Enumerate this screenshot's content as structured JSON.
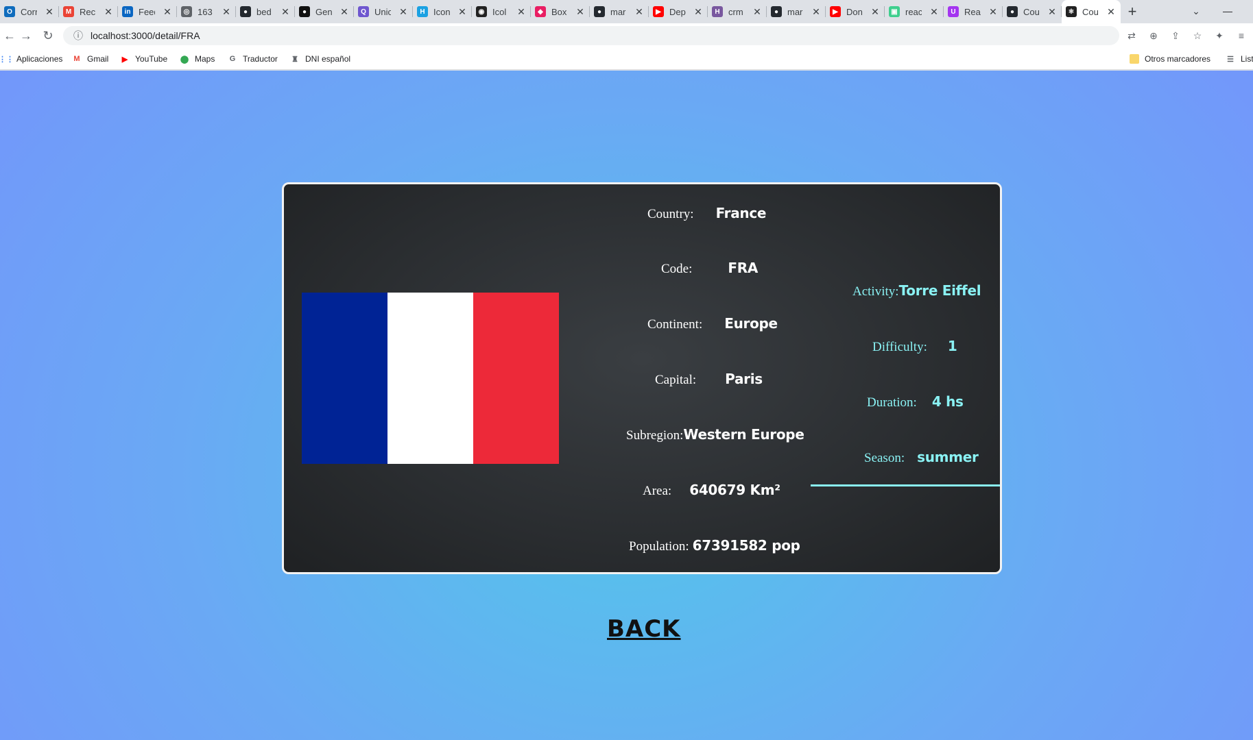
{
  "browser": {
    "tabs": [
      {
        "title": "Corr",
        "icon": "outlook-icon",
        "color": "#0f6cbd",
        "glyph": "O"
      },
      {
        "title": "Reci",
        "icon": "gmail-icon",
        "color": "#ea4335",
        "glyph": "M"
      },
      {
        "title": "Feed",
        "icon": "linkedin-icon",
        "color": "#0a66c2",
        "glyph": "in"
      },
      {
        "title": "163",
        "icon": "globe-icon",
        "color": "#5f6368",
        "glyph": "◎"
      },
      {
        "title": "bed",
        "icon": "github-icon",
        "color": "#24292f",
        "glyph": "●"
      },
      {
        "title": "Gen",
        "icon": "dot-icon",
        "color": "#111111",
        "glyph": "●"
      },
      {
        "title": "Unic",
        "icon": "search-icon",
        "color": "#6e56cf",
        "glyph": "Q"
      },
      {
        "title": "Icon",
        "icon": "iconify-icon",
        "color": "#1ba1e2",
        "glyph": "H"
      },
      {
        "title": "Icol",
        "icon": "icon-app-icon",
        "color": "#222222",
        "glyph": "◉"
      },
      {
        "title": "Box",
        "icon": "box-icon",
        "color": "#e91e63",
        "glyph": "◆"
      },
      {
        "title": "mar",
        "icon": "github-icon",
        "color": "#24292f",
        "glyph": "●"
      },
      {
        "title": "Dep",
        "icon": "youtube-icon",
        "color": "#ff0000",
        "glyph": "▶"
      },
      {
        "title": "crm",
        "icon": "heroku-icon",
        "color": "#79589f",
        "glyph": "H"
      },
      {
        "title": "mar",
        "icon": "github-icon",
        "color": "#24292f",
        "glyph": "●"
      },
      {
        "title": "Don",
        "icon": "youtube-icon",
        "color": "#ff0000",
        "glyph": "▶"
      },
      {
        "title": "reac",
        "icon": "react-app-icon",
        "color": "#3ecf8e",
        "glyph": "▣"
      },
      {
        "title": "Rea",
        "icon": "udemy-icon",
        "color": "#a435f0",
        "glyph": "U"
      },
      {
        "title": "Cou",
        "icon": "github-icon",
        "color": "#24292f",
        "glyph": "●"
      },
      {
        "title": "Cou",
        "icon": "react-icon",
        "color": "#222222",
        "glyph": "⚛",
        "active": true
      }
    ],
    "url": "localhost:3000/detail/FRA",
    "bookmarks": {
      "apps": "Aplicaciones",
      "gmail": "Gmail",
      "youtube": "YouTube",
      "maps": "Maps",
      "translate": "Traductor",
      "dni": "DNI español",
      "other": "Otros marcadores",
      "reading": "List"
    }
  },
  "country": {
    "country_label": "Country:",
    "country_value": "France",
    "code_label": "Code:",
    "code_value": "FRA",
    "continent_label": "Continent:",
    "continent_value": "Europe",
    "capital_label": "Capital:",
    "capital_value": "Paris",
    "subregion_label": "Subregion:",
    "subregion_value": "Western Europe",
    "area_label": "Area:",
    "area_value": "640679 Km²",
    "population_label": "Population:",
    "population_value": "67391582 pop"
  },
  "activity": {
    "activity_label": "Activity:",
    "activity_value": "Torre Eiffel",
    "difficulty_label": "Difficulty:",
    "difficulty_value": "1",
    "duration_label": "Duration:",
    "duration_value": "4 hs",
    "season_label": "Season:",
    "season_value": "summer"
  },
  "back_label": "BACK",
  "colors": {
    "flag_blue": "#002395",
    "flag_white": "#ffffff",
    "flag_red": "#ed2939",
    "activity_accent": "#8af2f4"
  }
}
